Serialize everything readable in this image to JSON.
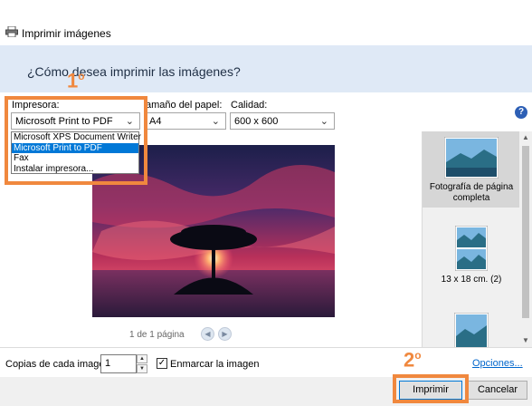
{
  "window": {
    "title": "Imprimir imágenes"
  },
  "header": {
    "question": "¿Cómo desea imprimir las imágenes?"
  },
  "printer": {
    "label": "Impresora:",
    "selected": "Microsoft Print to PDF",
    "options": [
      "Microsoft XPS Document Writer",
      "Microsoft Print to PDF",
      "Fax",
      "Instalar impresora..."
    ],
    "highlighted_index": 1
  },
  "paper_size": {
    "label": "Tamaño del papel:",
    "label_visible": "amaño del papel:",
    "selected": "A4",
    "selected_visible": "A4"
  },
  "quality": {
    "label": "Calidad:",
    "selected": "600 x 600"
  },
  "help": {
    "glyph": "?"
  },
  "annotations": {
    "badge1": "1",
    "badge2": "2",
    "ordinal": "o"
  },
  "preview": {
    "page_count": "1 de 1 página"
  },
  "layouts": [
    {
      "caption": "Fotografía de página completa",
      "selected": true
    },
    {
      "caption": "13 x 18 cm. (2)",
      "selected": false
    },
    {
      "caption": "",
      "selected": false
    }
  ],
  "copies": {
    "label": "Copias de cada imagen:",
    "value": "1"
  },
  "frame": {
    "label": "Enmarcar la imagen",
    "checked": true
  },
  "options_link": "Opciones...",
  "buttons": {
    "print": "Imprimir",
    "cancel": "Cancelar"
  },
  "colors": {
    "accent": "#0078d7",
    "annotation": "#f0883e",
    "header_band": "#dfe9f6"
  }
}
